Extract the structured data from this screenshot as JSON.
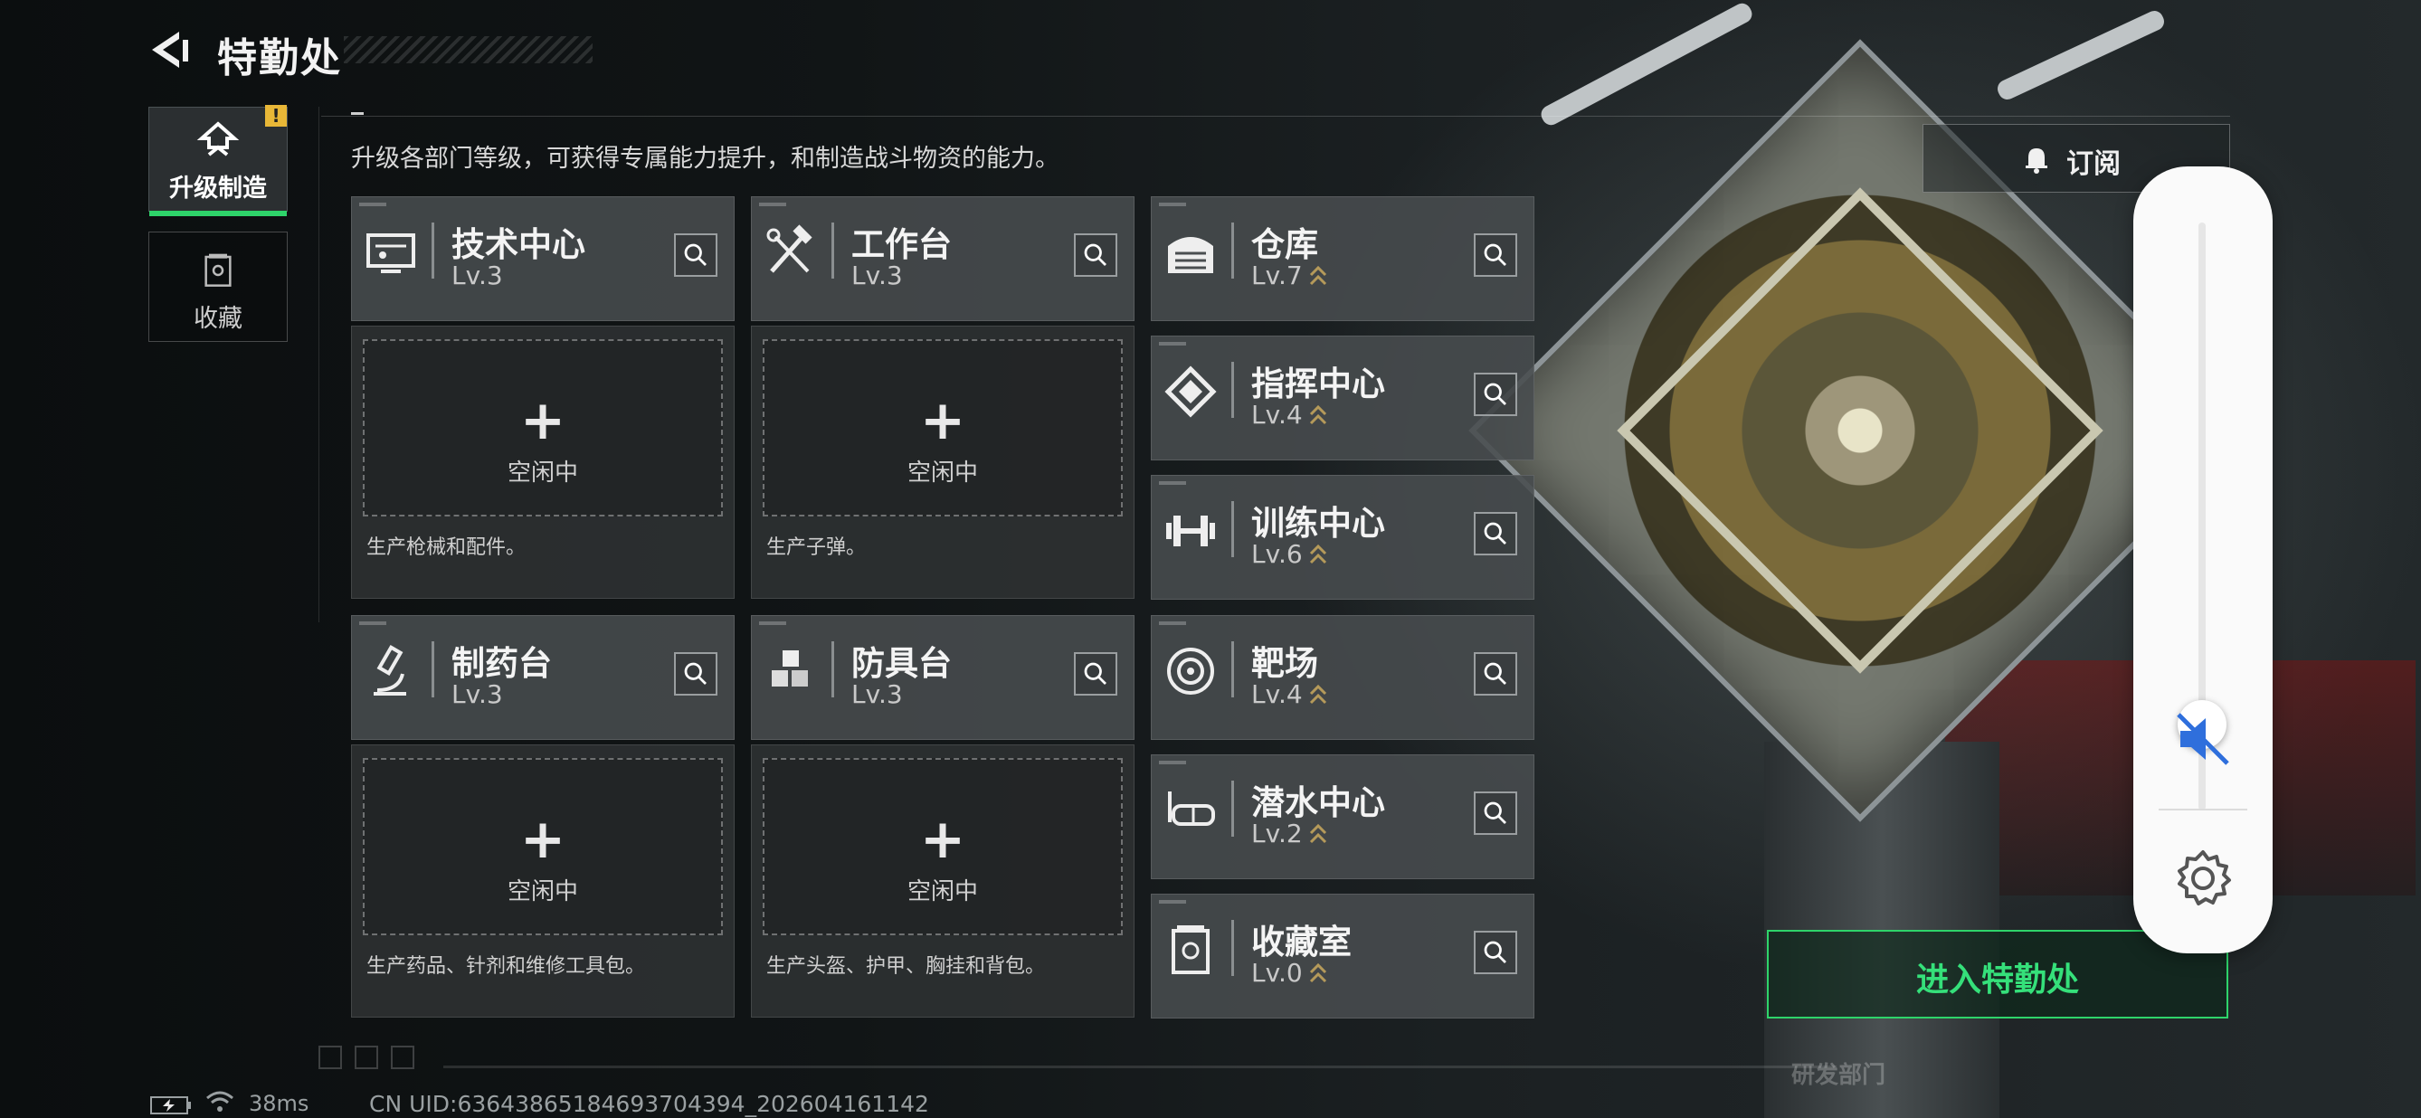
{
  "header": {
    "title": "特勤处"
  },
  "sidebar": {
    "tabs": [
      {
        "label": "升级制造",
        "badge": "!"
      },
      {
        "label": "收藏"
      }
    ]
  },
  "description": "升级各部门等级，可获得专属能力提升，和制造战斗物资的能力。",
  "subscribe_label": "订阅",
  "departments": {
    "tech": {
      "name": "技术中心",
      "level": "Lv.3",
      "idle": "空闲中",
      "desc": "生产枪械和配件。",
      "icon": "tech-center-icon"
    },
    "workbench": {
      "name": "工作台",
      "level": "Lv.3",
      "idle": "空闲中",
      "desc": "生产子弹。",
      "icon": "hammer-wrench-icon"
    },
    "pharmacy": {
      "name": "制药台",
      "level": "Lv.3",
      "idle": "空闲中",
      "desc": "生产药品、针剂和维修工具包。",
      "icon": "microscope-icon"
    },
    "armor": {
      "name": "防具台",
      "level": "Lv.3",
      "idle": "空闲中",
      "desc": "生产头盔、护甲、胸挂和背包。",
      "icon": "cubes-icon"
    },
    "warehouse": {
      "name": "仓库",
      "level": "Lv.7",
      "icon": "warehouse-icon"
    },
    "command": {
      "name": "指挥中心",
      "level": "Lv.4",
      "icon": "chip-icon"
    },
    "training": {
      "name": "训练中心",
      "level": "Lv.6",
      "icon": "dumbbell-icon"
    },
    "range": {
      "name": "靶场",
      "level": "Lv.4",
      "icon": "target-icon"
    },
    "diving": {
      "name": "潜水中心",
      "level": "Lv.2",
      "icon": "diving-mask-icon"
    },
    "collection": {
      "name": "收藏室",
      "level": "Lv.0",
      "icon": "trophy-case-icon"
    }
  },
  "enter_button": "进入特勤处",
  "volume": {
    "level": 0.1,
    "muted": true
  },
  "status": {
    "ping": "38ms",
    "uid": "CN UID:6364386518469370439​4_202604161142"
  },
  "watermark": "研发部门",
  "colors": {
    "accent_green": "#2ed46a",
    "alert_yellow": "#e8b737",
    "upgrade_gold": "#b59a5a"
  }
}
